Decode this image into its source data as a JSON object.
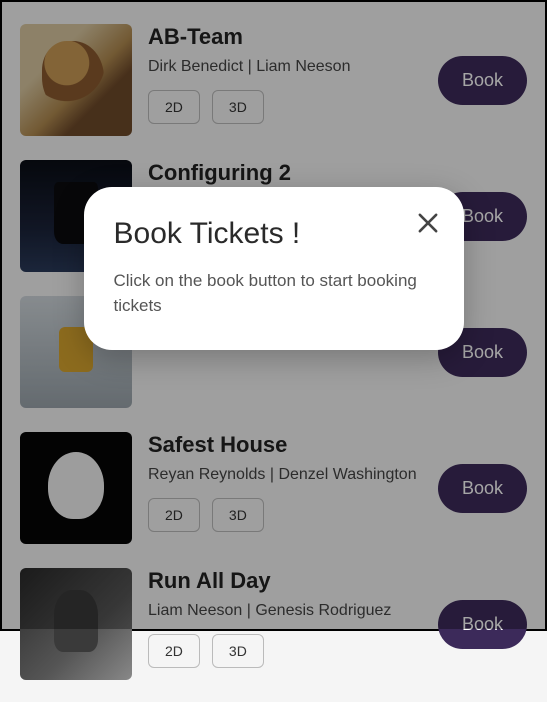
{
  "dialog": {
    "title": "Book Tickets !",
    "body": "Click on the book button to start booking tickets"
  },
  "book_label": "Book",
  "formats": [
    "2D",
    "3D"
  ],
  "movies": [
    {
      "title": "AB-Team",
      "cast": "Dirk Benedict | Liam Neeson"
    },
    {
      "title": "Configuring 2",
      "cast": ""
    },
    {
      "title": "",
      "cast": ""
    },
    {
      "title": "Safest House",
      "cast": "Reyan Reynolds | Denzel Washington"
    },
    {
      "title": "Run All Day",
      "cast": "Liam Neeson | Genesis Rodriguez"
    }
  ]
}
